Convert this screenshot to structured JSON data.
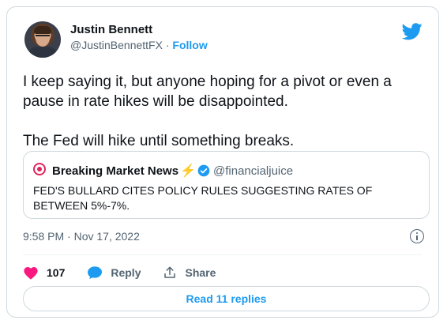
{
  "author": {
    "name": "Justin Bennett",
    "handle": "@JustinBennettFX",
    "separator": " · ",
    "follow_label": "Follow"
  },
  "tweet": {
    "line1": "I keep saying it, but anyone hoping for a pivot or even a",
    "line2": "pause in rate hikes will be disappointed.",
    "line3": "The Fed will hike until something breaks."
  },
  "quote": {
    "name": "Breaking Market News",
    "handle": "@financialjuice",
    "text": "FED'S BULLARD CITES POLICY RULES SUGGESTING RATES OF BETWEEN 5%-7%."
  },
  "timestamp": "9:58 PM · Nov 17, 2022",
  "actions": {
    "likes": "107",
    "reply_label": "Reply",
    "share_label": "Share"
  },
  "read_replies": "Read 11 replies",
  "colors": {
    "accent": "#1d9bf0",
    "like": "#f91880",
    "secondary_text": "#536471"
  }
}
